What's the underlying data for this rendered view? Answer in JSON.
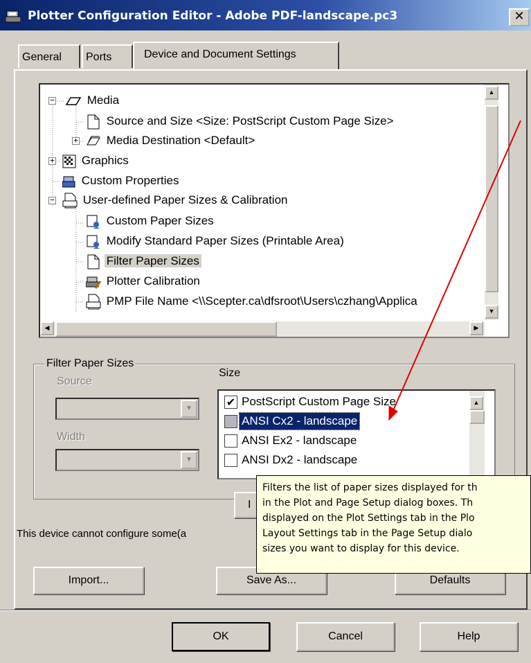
{
  "window": {
    "title": "Plotter Configuration Editor - Adobe PDF-landscape.pc3",
    "close_glyph": "✕"
  },
  "tabs": [
    {
      "label": "General",
      "active": false
    },
    {
      "label": "Ports",
      "active": false
    },
    {
      "label": "Device and Document Settings",
      "active": true
    }
  ],
  "tree": {
    "expand_minus": "−",
    "expand_plus": "+",
    "nodes": [
      {
        "label": "Media",
        "icon": "media-icon"
      },
      {
        "label": "Source and Size <Size: PostScript Custom Page Size>",
        "icon": "page-icon"
      },
      {
        "label": "Media Destination <Default>",
        "icon": "media-destination-icon"
      },
      {
        "label": "Graphics",
        "icon": "graphics-icon"
      },
      {
        "label": "Custom Properties",
        "icon": "custom-properties-icon"
      },
      {
        "label": "User-defined Paper Sizes & Calibration",
        "icon": "paper-sizes-icon"
      },
      {
        "label": "Custom Paper Sizes",
        "icon": "custom-paper-icon"
      },
      {
        "label": "Modify Standard Paper Sizes (Printable Area)",
        "icon": "modify-paper-icon"
      },
      {
        "label": "Filter Paper Sizes",
        "icon": "page-icon"
      },
      {
        "label": "Plotter Calibration",
        "icon": "calibration-icon"
      },
      {
        "label": "PMP File Name <\\\\Scepter.ca\\dfsroot\\Users\\czhang\\Applica",
        "icon": "pmp-file-icon"
      }
    ]
  },
  "filter_group": {
    "title": "Filter Paper Sizes",
    "source_label": "Source",
    "width_label": "Width",
    "size_label": "Size",
    "sizes": [
      {
        "label": "PostScript Custom Page Size",
        "checked": true
      },
      {
        "label": "ANSI Cx2 - landscape",
        "checked": false,
        "focused": true
      },
      {
        "label": "ANSI Ex2 - landscape",
        "checked": false
      },
      {
        "label": "ANSI Dx2 - landscape",
        "checked": false
      }
    ],
    "check_glyph": "✔"
  },
  "tooltip": {
    "text": "Filters the list of paper sizes displayed for th\nin the Plot and Page Setup dialog boxes. Th\ndisplayed on the Plot Settings tab in the Plo\nLayout Settings tab in the Page Setup dialo\nsizes you want to display for this device."
  },
  "status_text": "This device cannot configure some(a",
  "buttons": {
    "import": "Import...",
    "save_as": "Save As...",
    "defaults": "Defaults",
    "ok": "OK",
    "cancel": "Cancel",
    "help": "Help",
    "partial": "I"
  },
  "colors": {
    "accent": "#0a246a",
    "annotation_arrow": "#e00000",
    "tooltip_bg": "#ffffe1"
  }
}
